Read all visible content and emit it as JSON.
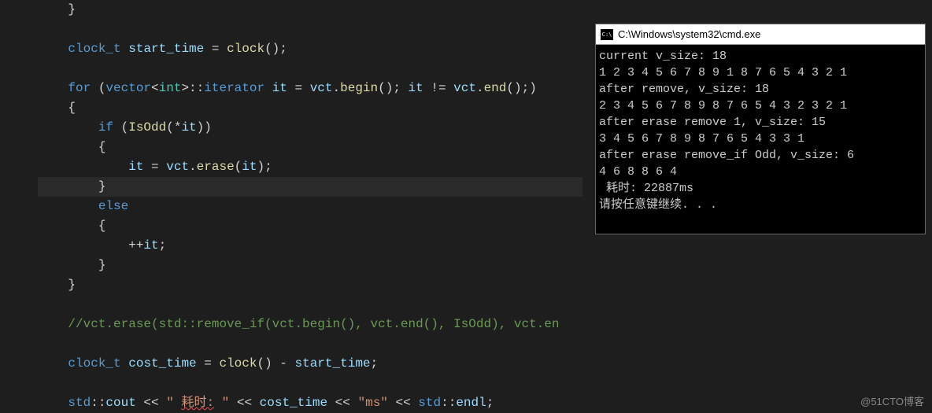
{
  "editor": {
    "lines": [
      {
        "indent": 1,
        "tokens": [
          {
            "t": "}",
            "c": "brace"
          }
        ]
      },
      {
        "indent": 0,
        "tokens": []
      },
      {
        "indent": 1,
        "tokens": [
          {
            "t": "clock_t",
            "c": "type"
          },
          {
            "t": " "
          },
          {
            "t": "start_time",
            "c": "var"
          },
          {
            "t": " = "
          },
          {
            "t": "clock",
            "c": "func"
          },
          {
            "t": "();",
            "c": "punct"
          }
        ]
      },
      {
        "indent": 0,
        "tokens": []
      },
      {
        "indent": 1,
        "tokens": [
          {
            "t": "for",
            "c": "kw"
          },
          {
            "t": " ("
          },
          {
            "t": "vector",
            "c": "type"
          },
          {
            "t": "<"
          },
          {
            "t": "int",
            "c": "num"
          },
          {
            "t": ">::"
          },
          {
            "t": "iterator",
            "c": "type"
          },
          {
            "t": " "
          },
          {
            "t": "it",
            "c": "var"
          },
          {
            "t": " = "
          },
          {
            "t": "vct",
            "c": "var"
          },
          {
            "t": "."
          },
          {
            "t": "begin",
            "c": "func"
          },
          {
            "t": "(); "
          },
          {
            "t": "it",
            "c": "var"
          },
          {
            "t": " != "
          },
          {
            "t": "vct",
            "c": "var"
          },
          {
            "t": "."
          },
          {
            "t": "end",
            "c": "func"
          },
          {
            "t": "();)"
          }
        ]
      },
      {
        "indent": 1,
        "tokens": [
          {
            "t": "{",
            "c": "brace"
          }
        ]
      },
      {
        "indent": 2,
        "tokens": [
          {
            "t": "if",
            "c": "kw"
          },
          {
            "t": " ("
          },
          {
            "t": "IsOdd",
            "c": "func"
          },
          {
            "t": "(*"
          },
          {
            "t": "it",
            "c": "var"
          },
          {
            "t": "))"
          }
        ]
      },
      {
        "indent": 2,
        "tokens": [
          {
            "t": "{",
            "c": "brace"
          }
        ]
      },
      {
        "indent": 3,
        "tokens": [
          {
            "t": "it",
            "c": "var"
          },
          {
            "t": " = "
          },
          {
            "t": "vct",
            "c": "var"
          },
          {
            "t": "."
          },
          {
            "t": "erase",
            "c": "func"
          },
          {
            "t": "("
          },
          {
            "t": "it",
            "c": "var"
          },
          {
            "t": ");"
          }
        ]
      },
      {
        "indent": 2,
        "highlight": true,
        "tokens": [
          {
            "t": "}",
            "c": "brace"
          }
        ]
      },
      {
        "indent": 2,
        "tokens": [
          {
            "t": "else",
            "c": "kw"
          }
        ]
      },
      {
        "indent": 2,
        "tokens": [
          {
            "t": "{",
            "c": "brace"
          }
        ]
      },
      {
        "indent": 3,
        "tokens": [
          {
            "t": "++",
            "c": "op"
          },
          {
            "t": "it",
            "c": "var"
          },
          {
            "t": ";"
          }
        ]
      },
      {
        "indent": 2,
        "tokens": [
          {
            "t": "}",
            "c": "brace"
          }
        ]
      },
      {
        "indent": 1,
        "tokens": [
          {
            "t": "}",
            "c": "brace"
          }
        ]
      },
      {
        "indent": 0,
        "tokens": []
      },
      {
        "indent": 1,
        "tokens": [
          {
            "t": "//vct.erase(std::remove_if(vct.begin(), vct.end(), IsOdd), vct.en",
            "c": "comment"
          }
        ]
      },
      {
        "indent": 0,
        "tokens": []
      },
      {
        "indent": 1,
        "tokens": [
          {
            "t": "clock_t",
            "c": "type"
          },
          {
            "t": " "
          },
          {
            "t": "cost_time",
            "c": "var"
          },
          {
            "t": " = "
          },
          {
            "t": "clock",
            "c": "func"
          },
          {
            "t": "() - "
          },
          {
            "t": "start_time",
            "c": "var"
          },
          {
            "t": ";"
          }
        ]
      },
      {
        "indent": 0,
        "tokens": []
      },
      {
        "indent": 1,
        "tokens": [
          {
            "t": "std",
            "c": "type"
          },
          {
            "t": "::"
          },
          {
            "t": "cout",
            "c": "var"
          },
          {
            "t": " << "
          },
          {
            "t": "\" ",
            "c": "str"
          },
          {
            "t": "耗时:",
            "c": "str",
            "err": true
          },
          {
            "t": " \"",
            "c": "str"
          },
          {
            "t": " << "
          },
          {
            "t": "cost_time",
            "c": "var"
          },
          {
            "t": " << "
          },
          {
            "t": "\"ms\"",
            "c": "str"
          },
          {
            "t": " << "
          },
          {
            "t": "std",
            "c": "type"
          },
          {
            "t": "::"
          },
          {
            "t": "endl",
            "c": "var"
          },
          {
            "t": ";"
          }
        ]
      }
    ]
  },
  "terminal": {
    "title": "C:\\Windows\\system32\\cmd.exe",
    "lines": [
      "current v_size: 18",
      "1 2 3 4 5 6 7 8 9 1 8 7 6 5 4 3 2 1",
      "after remove, v_size: 18",
      "2 3 4 5 6 7 8 9 8 7 6 5 4 3 2 3 2 1",
      "after erase remove 1, v_size: 15",
      "3 4 5 6 7 8 9 8 7 6 5 4 3 3 1",
      "after erase remove_if Odd, v_size: 6",
      "4 6 8 8 6 4",
      " 耗时: 22887ms",
      "请按任意键继续. . ."
    ]
  },
  "watermark": "@51CTO博客"
}
